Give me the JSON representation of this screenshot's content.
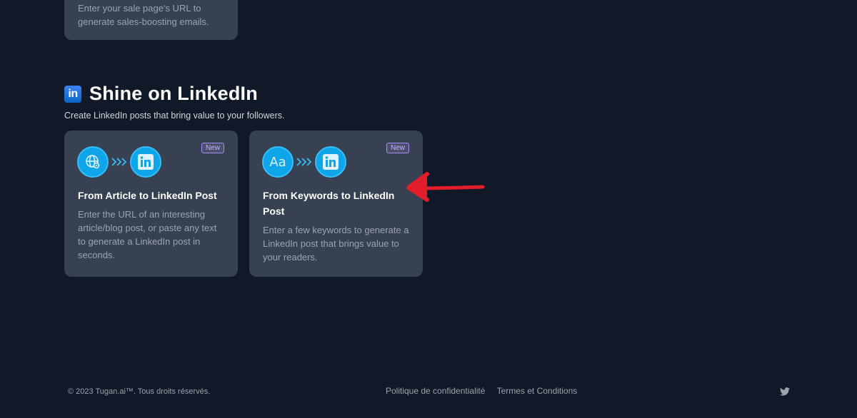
{
  "top_card": {
    "description": "Enter your sale page's URL to generate sales-boosting emails."
  },
  "section": {
    "logo_text": "in",
    "title": "Shine on LinkedIn",
    "subtitle": "Create LinkedIn posts that bring value to your followers."
  },
  "cards": [
    {
      "badge": "New",
      "title": "From Article to LinkedIn Post",
      "description": "Enter the URL of an interesting article/blog post, or paste any text to generate a LinkedIn post in seconds.",
      "source_icon": "globe-link-icon",
      "target_icon": "linkedin-icon"
    },
    {
      "badge": "New",
      "title": "From Keywords to LinkedIn Post",
      "description": "Enter a few keywords to generate a LinkedIn post that brings value to your readers.",
      "source_icon_text": "Aa",
      "target_icon": "linkedin-icon"
    }
  ],
  "footer": {
    "copyright": "© 2023  Tugan.ai™. Tous droits réservés.",
    "links": [
      "Politique de confidentialité",
      "Termes et Conditions"
    ],
    "social_icon": "twitter-icon"
  },
  "colors": {
    "background": "#111827",
    "card": "#374151",
    "accent": "#0ea5e9",
    "annotation_arrow": "#e11d2a"
  }
}
